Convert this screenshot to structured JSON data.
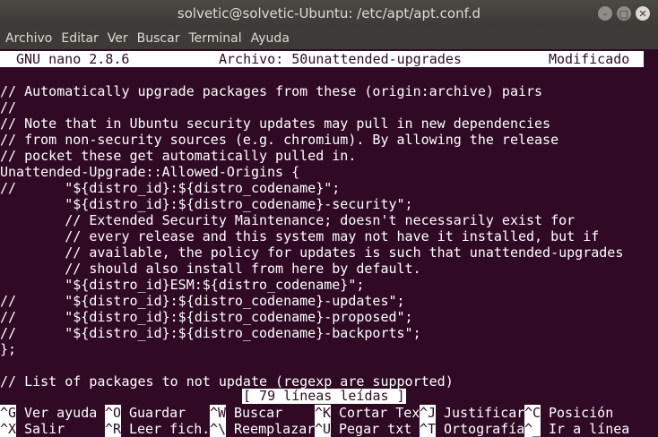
{
  "window": {
    "title": "solvetic@solvetic-Ubuntu: /etc/apt/apt.conf.d",
    "minimize_glyph": "–",
    "maximize_glyph": "▢",
    "close_glyph": "✕"
  },
  "menu": [
    "Archivo",
    "Editar",
    "Ver",
    "Buscar",
    "Terminal",
    "Ayuda"
  ],
  "nano": {
    "version": "GNU nano 2.8.6",
    "file": "Archivo: 50unattended-upgrades",
    "state": "Modificado"
  },
  "lines": [
    "",
    "// Automatically upgrade packages from these (origin:archive) pairs",
    "//",
    "// Note that in Ubuntu security updates may pull in new dependencies",
    "// from non-security sources (e.g. chromium). By allowing the release",
    "// pocket these get automatically pulled in.",
    "Unattended-Upgrade::Allowed-Origins {",
    "//      \"${distro_id}:${distro_codename}\";",
    "        \"${distro_id}:${distro_codename}-security\";",
    "        // Extended Security Maintenance; doesn't necessarily exist for",
    "        // every release and this system may not have it installed, but if",
    "        // available, the policy for updates is such that unattended-upgrades",
    "        // should also install from here by default.",
    "        \"${distro_id}ESM:${distro_codename}\";",
    "//      \"${distro_id}:${distro_codename}-updates\";",
    "//      \"${distro_id}:${distro_codename}-proposed\";",
    "//      \"${distro_id}:${distro_codename}-backports\";",
    "};",
    "",
    "// List of packages to not update (regexp are supported)"
  ],
  "status_message": "[ 79 líneas leídas ]",
  "shortcuts": [
    [
      {
        "key": "^G",
        "label": "Ver ayuda"
      },
      {
        "key": "^O",
        "label": "Guardar"
      },
      {
        "key": "^W",
        "label": "Buscar"
      },
      {
        "key": "^K",
        "label": "Cortar Tex"
      },
      {
        "key": "^J",
        "label": "Justificar"
      },
      {
        "key": "^C",
        "label": "Posición"
      }
    ],
    [
      {
        "key": "^X",
        "label": "Salir"
      },
      {
        "key": "^R",
        "label": "Leer fich."
      },
      {
        "key": "^\\",
        "label": "Reemplazar"
      },
      {
        "key": "^U",
        "label": "Pegar txt"
      },
      {
        "key": "^T",
        "label": "Ortografía"
      },
      {
        "key": "^_",
        "label": "Ir a línea"
      }
    ]
  ],
  "colors": {
    "terminal_bg": "#300a24",
    "terminal_fg": "#ffffff",
    "titlebar_bg": "#3b3a36"
  }
}
